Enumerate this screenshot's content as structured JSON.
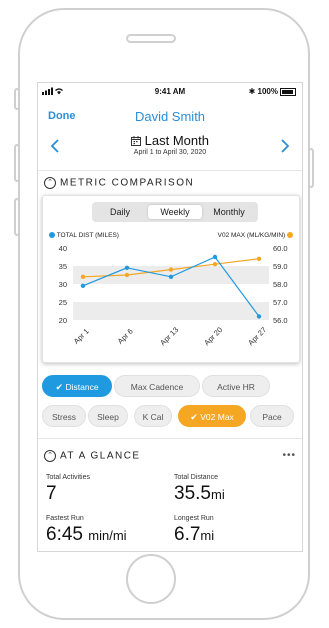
{
  "status": {
    "time": "9:41 AM",
    "battery": "100%"
  },
  "nav": {
    "done": "Done",
    "title": "David Smith"
  },
  "range": {
    "title": "Last Month",
    "subtitle": "April 1 to April 30, 2020",
    "prev_icon": "chevron-left-icon",
    "next_icon": "chevron-right-icon",
    "calendar_icon": "calendar-icon"
  },
  "metric": {
    "header": "METRIC COMPARISON",
    "tabs": [
      "Daily",
      "Weekly",
      "Monthly"
    ],
    "selected_tab": "Weekly"
  },
  "colors": {
    "accent": "#2a8ed8",
    "distance": "#1f9ae0",
    "vo2": "#f5a623"
  },
  "chart_data": {
    "type": "line",
    "categories": [
      "Apr 1",
      "Apr 6",
      "Apr 13",
      "Apr 20",
      "Apr 27"
    ],
    "series": [
      {
        "name": "TOTAL DIST (MILES)",
        "axis": "left",
        "values": [
          29.5,
          34.5,
          32,
          37.5,
          21
        ]
      },
      {
        "name": "V02 MAX (ML/KG/MIN)",
        "axis": "right",
        "values": [
          58.4,
          58.5,
          58.8,
          59.1,
          59.4
        ]
      }
    ],
    "left_ticks": [
      "40",
      "35",
      "30",
      "25",
      "20"
    ],
    "right_ticks": [
      "60.0",
      "59.0",
      "58.0",
      "57.0",
      "56.0"
    ],
    "ylim_left": [
      20,
      40
    ],
    "ylim_right": [
      56,
      60
    ],
    "legend": "top"
  },
  "chips": [
    {
      "label": "Distance",
      "state": "blue",
      "check": true
    },
    {
      "label": "Max Cadence",
      "state": "gray"
    },
    {
      "label": "Active HR",
      "state": "gray"
    },
    {
      "label": "Stress",
      "state": "gray"
    },
    {
      "label": "Sleep",
      "state": "gray"
    },
    {
      "label": "K Cal",
      "state": "gray"
    },
    {
      "label": "V02 Max",
      "state": "orange",
      "check": true
    },
    {
      "label": "Pace",
      "state": "gray"
    }
  ],
  "glance": {
    "header": "AT A GLANCE",
    "more": "•••",
    "total_activities_label": "Total Activities",
    "total_activities": "7",
    "total_distance_label": "Total Distance",
    "total_distance": "35.5",
    "total_distance_unit": "mi",
    "fastest_run_label": "Fastest Run",
    "fastest_run": "6:45",
    "fastest_run_unit": "min/mi",
    "longest_run_label": "Longest Run",
    "longest_run": "6.7",
    "longest_run_unit": "mi"
  }
}
